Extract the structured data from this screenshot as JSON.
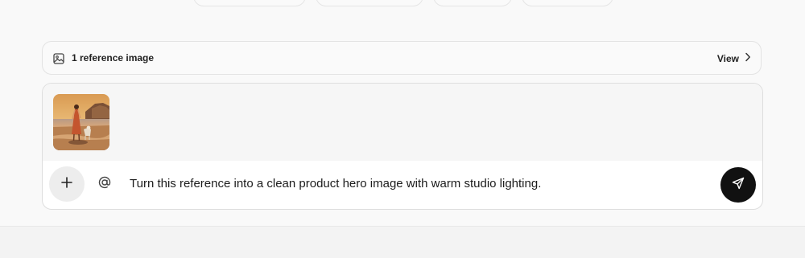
{
  "reference_bar": {
    "label": "1 reference image",
    "view_label": "View",
    "icon": "image-icon",
    "chevron_icon": "chevron-right-icon"
  },
  "composer": {
    "prompt_text": "Turn this reference into a clean product hero image with warm studio lighting.",
    "attachments": [
      {
        "kind": "image",
        "description_icon": "thumbnail"
      }
    ],
    "plus_icon": "plus-icon",
    "mention_icon": "at-icon",
    "send_icon": "send-icon"
  },
  "colors": {
    "background": "#f9f9f9",
    "send_button": "#111111",
    "plus_button": "#ededed"
  }
}
